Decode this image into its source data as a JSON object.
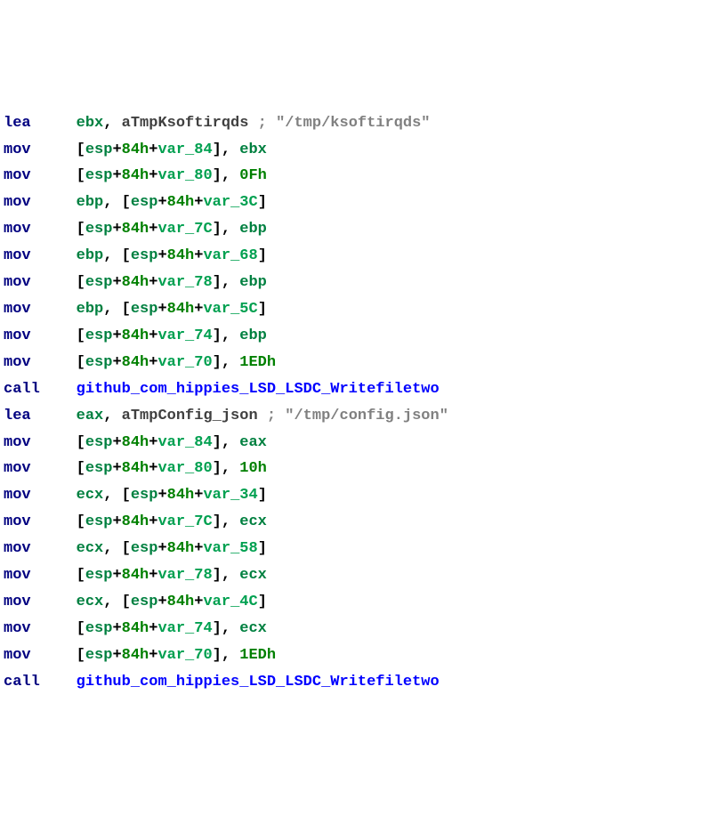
{
  "lines": [
    {
      "mnemonic": "lea",
      "ops": [
        {
          "t": "reg",
          "v": "ebx"
        },
        {
          "t": "plain",
          "v": ", "
        },
        {
          "t": "label",
          "v": "aTmpKsoftirqds "
        },
        {
          "t": "comment",
          "v": "; \"/tmp/ksoftirqds\""
        }
      ]
    },
    {
      "mnemonic": "mov",
      "ops": [
        {
          "t": "punct",
          "v": "["
        },
        {
          "t": "reg",
          "v": "esp"
        },
        {
          "t": "punct",
          "v": "+"
        },
        {
          "t": "num",
          "v": "84h"
        },
        {
          "t": "punct",
          "v": "+"
        },
        {
          "t": "var",
          "v": "var_84"
        },
        {
          "t": "punct",
          "v": "], "
        },
        {
          "t": "reg",
          "v": "ebx"
        }
      ]
    },
    {
      "mnemonic": "mov",
      "ops": [
        {
          "t": "punct",
          "v": "["
        },
        {
          "t": "reg",
          "v": "esp"
        },
        {
          "t": "punct",
          "v": "+"
        },
        {
          "t": "num",
          "v": "84h"
        },
        {
          "t": "punct",
          "v": "+"
        },
        {
          "t": "var",
          "v": "var_80"
        },
        {
          "t": "punct",
          "v": "], "
        },
        {
          "t": "num",
          "v": "0Fh"
        }
      ]
    },
    {
      "mnemonic": "mov",
      "ops": [
        {
          "t": "reg",
          "v": "ebp"
        },
        {
          "t": "punct",
          "v": ", ["
        },
        {
          "t": "reg",
          "v": "esp"
        },
        {
          "t": "punct",
          "v": "+"
        },
        {
          "t": "num",
          "v": "84h"
        },
        {
          "t": "punct",
          "v": "+"
        },
        {
          "t": "var",
          "v": "var_3C"
        },
        {
          "t": "punct",
          "v": "]"
        }
      ]
    },
    {
      "mnemonic": "mov",
      "ops": [
        {
          "t": "punct",
          "v": "["
        },
        {
          "t": "reg",
          "v": "esp"
        },
        {
          "t": "punct",
          "v": "+"
        },
        {
          "t": "num",
          "v": "84h"
        },
        {
          "t": "punct",
          "v": "+"
        },
        {
          "t": "var",
          "v": "var_7C"
        },
        {
          "t": "punct",
          "v": "], "
        },
        {
          "t": "reg",
          "v": "ebp"
        }
      ]
    },
    {
      "mnemonic": "mov",
      "ops": [
        {
          "t": "reg",
          "v": "ebp"
        },
        {
          "t": "punct",
          "v": ", ["
        },
        {
          "t": "reg",
          "v": "esp"
        },
        {
          "t": "punct",
          "v": "+"
        },
        {
          "t": "num",
          "v": "84h"
        },
        {
          "t": "punct",
          "v": "+"
        },
        {
          "t": "var",
          "v": "var_68"
        },
        {
          "t": "punct",
          "v": "]"
        }
      ]
    },
    {
      "mnemonic": "mov",
      "ops": [
        {
          "t": "punct",
          "v": "["
        },
        {
          "t": "reg",
          "v": "esp"
        },
        {
          "t": "punct",
          "v": "+"
        },
        {
          "t": "num",
          "v": "84h"
        },
        {
          "t": "punct",
          "v": "+"
        },
        {
          "t": "var",
          "v": "var_78"
        },
        {
          "t": "punct",
          "v": "], "
        },
        {
          "t": "reg",
          "v": "ebp"
        }
      ]
    },
    {
      "mnemonic": "mov",
      "ops": [
        {
          "t": "reg",
          "v": "ebp"
        },
        {
          "t": "punct",
          "v": ", ["
        },
        {
          "t": "reg",
          "v": "esp"
        },
        {
          "t": "punct",
          "v": "+"
        },
        {
          "t": "num",
          "v": "84h"
        },
        {
          "t": "punct",
          "v": "+"
        },
        {
          "t": "var",
          "v": "var_5C"
        },
        {
          "t": "punct",
          "v": "]"
        }
      ]
    },
    {
      "mnemonic": "mov",
      "ops": [
        {
          "t": "punct",
          "v": "["
        },
        {
          "t": "reg",
          "v": "esp"
        },
        {
          "t": "punct",
          "v": "+"
        },
        {
          "t": "num",
          "v": "84h"
        },
        {
          "t": "punct",
          "v": "+"
        },
        {
          "t": "var",
          "v": "var_74"
        },
        {
          "t": "punct",
          "v": "], "
        },
        {
          "t": "reg",
          "v": "ebp"
        }
      ]
    },
    {
      "mnemonic": "mov",
      "ops": [
        {
          "t": "punct",
          "v": "["
        },
        {
          "t": "reg",
          "v": "esp"
        },
        {
          "t": "punct",
          "v": "+"
        },
        {
          "t": "num",
          "v": "84h"
        },
        {
          "t": "punct",
          "v": "+"
        },
        {
          "t": "var",
          "v": "var_70"
        },
        {
          "t": "punct",
          "v": "], "
        },
        {
          "t": "num",
          "v": "1EDh"
        }
      ]
    },
    {
      "mnemonic": "call",
      "ops": [
        {
          "t": "func",
          "v": "github_com_hippies_LSD_LSDC_Writefiletwo"
        }
      ]
    },
    {
      "mnemonic": "lea",
      "ops": [
        {
          "t": "reg",
          "v": "eax"
        },
        {
          "t": "plain",
          "v": ", "
        },
        {
          "t": "label",
          "v": "aTmpConfig_json "
        },
        {
          "t": "comment",
          "v": "; \"/tmp/config.json\""
        }
      ]
    },
    {
      "mnemonic": "mov",
      "ops": [
        {
          "t": "punct",
          "v": "["
        },
        {
          "t": "reg",
          "v": "esp"
        },
        {
          "t": "punct",
          "v": "+"
        },
        {
          "t": "num",
          "v": "84h"
        },
        {
          "t": "punct",
          "v": "+"
        },
        {
          "t": "var",
          "v": "var_84"
        },
        {
          "t": "punct",
          "v": "], "
        },
        {
          "t": "reg",
          "v": "eax"
        }
      ]
    },
    {
      "mnemonic": "mov",
      "ops": [
        {
          "t": "punct",
          "v": "["
        },
        {
          "t": "reg",
          "v": "esp"
        },
        {
          "t": "punct",
          "v": "+"
        },
        {
          "t": "num",
          "v": "84h"
        },
        {
          "t": "punct",
          "v": "+"
        },
        {
          "t": "var",
          "v": "var_80"
        },
        {
          "t": "punct",
          "v": "], "
        },
        {
          "t": "num",
          "v": "10h"
        }
      ]
    },
    {
      "mnemonic": "mov",
      "ops": [
        {
          "t": "reg",
          "v": "ecx"
        },
        {
          "t": "punct",
          "v": ", ["
        },
        {
          "t": "reg",
          "v": "esp"
        },
        {
          "t": "punct",
          "v": "+"
        },
        {
          "t": "num",
          "v": "84h"
        },
        {
          "t": "punct",
          "v": "+"
        },
        {
          "t": "var",
          "v": "var_34"
        },
        {
          "t": "punct",
          "v": "]"
        }
      ]
    },
    {
      "mnemonic": "mov",
      "ops": [
        {
          "t": "punct",
          "v": "["
        },
        {
          "t": "reg",
          "v": "esp"
        },
        {
          "t": "punct",
          "v": "+"
        },
        {
          "t": "num",
          "v": "84h"
        },
        {
          "t": "punct",
          "v": "+"
        },
        {
          "t": "var",
          "v": "var_7C"
        },
        {
          "t": "punct",
          "v": "], "
        },
        {
          "t": "reg",
          "v": "ecx"
        }
      ]
    },
    {
      "mnemonic": "mov",
      "ops": [
        {
          "t": "reg",
          "v": "ecx"
        },
        {
          "t": "punct",
          "v": ", ["
        },
        {
          "t": "reg",
          "v": "esp"
        },
        {
          "t": "punct",
          "v": "+"
        },
        {
          "t": "num",
          "v": "84h"
        },
        {
          "t": "punct",
          "v": "+"
        },
        {
          "t": "var",
          "v": "var_58"
        },
        {
          "t": "punct",
          "v": "]"
        }
      ]
    },
    {
      "mnemonic": "mov",
      "ops": [
        {
          "t": "punct",
          "v": "["
        },
        {
          "t": "reg",
          "v": "esp"
        },
        {
          "t": "punct",
          "v": "+"
        },
        {
          "t": "num",
          "v": "84h"
        },
        {
          "t": "punct",
          "v": "+"
        },
        {
          "t": "var",
          "v": "var_78"
        },
        {
          "t": "punct",
          "v": "], "
        },
        {
          "t": "reg",
          "v": "ecx"
        }
      ]
    },
    {
      "mnemonic": "mov",
      "ops": [
        {
          "t": "reg",
          "v": "ecx"
        },
        {
          "t": "punct",
          "v": ", ["
        },
        {
          "t": "reg",
          "v": "esp"
        },
        {
          "t": "punct",
          "v": "+"
        },
        {
          "t": "num",
          "v": "84h"
        },
        {
          "t": "punct",
          "v": "+"
        },
        {
          "t": "var",
          "v": "var_4C"
        },
        {
          "t": "punct",
          "v": "]"
        }
      ]
    },
    {
      "mnemonic": "mov",
      "ops": [
        {
          "t": "punct",
          "v": "["
        },
        {
          "t": "reg",
          "v": "esp"
        },
        {
          "t": "punct",
          "v": "+"
        },
        {
          "t": "num",
          "v": "84h"
        },
        {
          "t": "punct",
          "v": "+"
        },
        {
          "t": "var",
          "v": "var_74"
        },
        {
          "t": "punct",
          "v": "], "
        },
        {
          "t": "reg",
          "v": "ecx"
        }
      ]
    },
    {
      "mnemonic": "mov",
      "ops": [
        {
          "t": "punct",
          "v": "["
        },
        {
          "t": "reg",
          "v": "esp"
        },
        {
          "t": "punct",
          "v": "+"
        },
        {
          "t": "num",
          "v": "84h"
        },
        {
          "t": "punct",
          "v": "+"
        },
        {
          "t": "var",
          "v": "var_70"
        },
        {
          "t": "punct",
          "v": "], "
        },
        {
          "t": "num",
          "v": "1EDh"
        }
      ]
    },
    {
      "mnemonic": "call",
      "ops": [
        {
          "t": "func",
          "v": "github_com_hippies_LSD_LSDC_Writefiletwo"
        }
      ]
    }
  ],
  "mnemonic_col_width": 8
}
